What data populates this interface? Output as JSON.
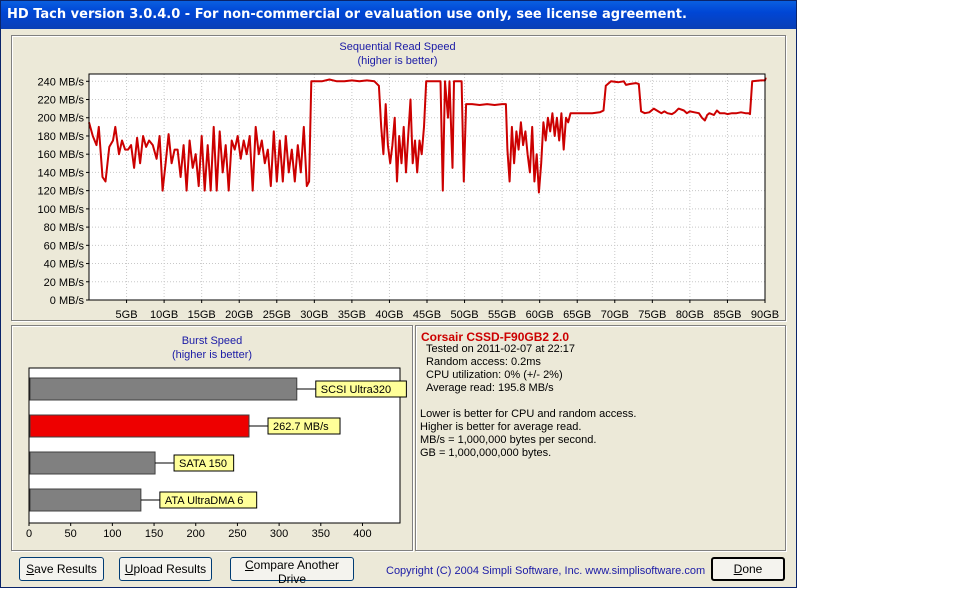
{
  "window": {
    "title": "HD Tach version 3.0.4.0  - For non-commercial or evaluation use only, see license agreement."
  },
  "sequential_chart": {
    "title": "Sequential Read Speed",
    "subtitle": "(higher is better)"
  },
  "burst_chart": {
    "title": "Burst Speed",
    "subtitle": "(higher is better)"
  },
  "info": {
    "drive_name": "Corsair CSSD-F90GB2 2.0",
    "tested_on": "Tested on 2011-02-07 at 22:17",
    "random_access": "Random access: 0.2ms",
    "cpu_utilization": "CPU utilization: 0% (+/- 2%)",
    "average_read": "Average read: 195.8 MB/s",
    "note1": "Lower is better for CPU and random access.",
    "note2": "Higher is better for average read.",
    "note3": "MB/s = 1,000,000 bytes per second.",
    "note4": "GB = 1,000,000,000 bytes."
  },
  "buttons": {
    "save_first": "S",
    "save_rest": "ave Results",
    "upload_first": "U",
    "upload_rest": "pload Results",
    "compare_first": "C",
    "compare_rest": "ompare Another Drive",
    "done_first": "D",
    "done_rest": "one"
  },
  "copyright": "Copyright (C) 2004 Simpli Software, Inc. www.simplisoftware.com",
  "colors": {
    "read_line": "#cc0000",
    "bar_default": "#808080",
    "bar_highlight": "#ee0000",
    "label_bg": "#ffff99",
    "chart_title": "#1a1aa6"
  },
  "chart_data": [
    {
      "type": "line",
      "title": "Sequential Read Speed",
      "subtitle": "(higher is better)",
      "x_ticks": [
        "5GB",
        "10GB",
        "15GB",
        "20GB",
        "25GB",
        "30GB",
        "35GB",
        "40GB",
        "45GB",
        "50GB",
        "55GB",
        "60GB",
        "65GB",
        "70GB",
        "75GB",
        "80GB",
        "85GB",
        "90GB"
      ],
      "y_ticks": [
        "0 MB/s",
        "20 MB/s",
        "40 MB/s",
        "60 MB/s",
        "80 MB/s",
        "100 MB/s",
        "120 MB/s",
        "140 MB/s",
        "160 MB/s",
        "180 MB/s",
        "200 MB/s",
        "220 MB/s",
        "240 MB/s"
      ],
      "xlim": [
        0,
        90
      ],
      "ylim": [
        0,
        248
      ],
      "grid": true,
      "series": [
        {
          "values": [
            [
              0,
              195
            ],
            [
              0.5,
              180
            ],
            [
              1,
              170
            ],
            [
              1.3,
              190
            ],
            [
              1.8,
              135
            ],
            [
              2.2,
              130
            ],
            [
              2.7,
              168
            ],
            [
              3.2,
              175
            ],
            [
              3.5,
              190
            ],
            [
              4,
              160
            ],
            [
              4.4,
              175
            ],
            [
              4.8,
              165
            ],
            [
              5.2,
              165
            ],
            [
              5.6,
              170
            ],
            [
              6,
              145
            ],
            [
              6.4,
              178
            ],
            [
              6.8,
              150
            ],
            [
              7.2,
              180
            ],
            [
              7.6,
              168
            ],
            [
              8,
              175
            ],
            [
              8.5,
              170
            ],
            [
              9,
              155
            ],
            [
              9.4,
              180
            ],
            [
              9.8,
              120
            ],
            [
              10.2,
              150
            ],
            [
              10.6,
              182
            ],
            [
              11,
              150
            ],
            [
              11.4,
              165
            ],
            [
              11.8,
              165
            ],
            [
              12.2,
              135
            ],
            [
              12.6,
              170
            ],
            [
              13,
              120
            ],
            [
              13.4,
              175
            ],
            [
              13.8,
              145
            ],
            [
              14.2,
              160
            ],
            [
              14.6,
              125
            ],
            [
              15,
              180
            ],
            [
              15.4,
              120
            ],
            [
              15.8,
              170
            ],
            [
              16.2,
              120
            ],
            [
              16.6,
              190
            ],
            [
              17,
              120
            ],
            [
              17.4,
              185
            ],
            [
              17.8,
              140
            ],
            [
              18.2,
              170
            ],
            [
              18.6,
              120
            ],
            [
              19,
              175
            ],
            [
              19.4,
              165
            ],
            [
              19.8,
              180
            ],
            [
              20.2,
              155
            ],
            [
              20.6,
              175
            ],
            [
              21,
              160
            ],
            [
              21.4,
              180
            ],
            [
              21.8,
              120
            ],
            [
              22.2,
              190
            ],
            [
              22.6,
              160
            ],
            [
              23,
              175
            ],
            [
              23.4,
              150
            ],
            [
              23.8,
              165
            ],
            [
              24.2,
              125
            ],
            [
              24.6,
              185
            ],
            [
              25,
              130
            ],
            [
              25.4,
              175
            ],
            [
              25.8,
              130
            ],
            [
              26.2,
              180
            ],
            [
              26.6,
              140
            ],
            [
              27,
              165
            ],
            [
              27.4,
              130
            ],
            [
              27.8,
              170
            ],
            [
              28.2,
              140
            ],
            [
              28.6,
              190
            ],
            [
              29,
              125
            ],
            [
              29.3,
              130
            ],
            [
              29.6,
              240
            ],
            [
              31,
              240
            ],
            [
              32,
              242
            ],
            [
              33,
              240
            ],
            [
              34,
              240
            ],
            [
              35,
              241
            ],
            [
              36,
              240
            ],
            [
              37,
              241
            ],
            [
              38,
              240
            ],
            [
              38.6,
              235
            ],
            [
              38.9,
              190
            ],
            [
              39.2,
              160
            ],
            [
              39.5,
              215
            ],
            [
              39.8,
              170
            ],
            [
              40.1,
              150
            ],
            [
              40.4,
              170
            ],
            [
              40.7,
              200
            ],
            [
              41,
              130
            ],
            [
              41.3,
              180
            ],
            [
              41.6,
              150
            ],
            [
              41.9,
              190
            ],
            [
              42.2,
              140
            ],
            [
              42.5,
              180
            ],
            [
              42.8,
              220
            ],
            [
              43.1,
              150
            ],
            [
              43.4,
              175
            ],
            [
              43.7,
              140
            ],
            [
              44,
              175
            ],
            [
              44.3,
              160
            ],
            [
              44.6,
              190
            ],
            [
              44.9,
              240
            ],
            [
              46.5,
              240
            ],
            [
              46.8,
              240
            ],
            [
              47.1,
              120
            ],
            [
              47.4,
              240
            ],
            [
              47.8,
              200
            ],
            [
              48,
              240
            ],
            [
              48.4,
              145
            ],
            [
              48.6,
              240
            ],
            [
              49.6,
              240
            ],
            [
              49.9,
              130
            ],
            [
              50.2,
              215
            ],
            [
              51,
              215
            ],
            [
              52,
              214
            ],
            [
              53,
              215
            ],
            [
              54,
              214
            ],
            [
              55,
              215
            ],
            [
              55.5,
              215
            ],
            [
              55.7,
              165
            ],
            [
              56,
              130
            ],
            [
              56.3,
              190
            ],
            [
              56.6,
              150
            ],
            [
              56.9,
              185
            ],
            [
              57.2,
              165
            ],
            [
              57.5,
              195
            ],
            [
              57.8,
              170
            ],
            [
              58.1,
              185
            ],
            [
              58.4,
              160
            ],
            [
              58.7,
              140
            ],
            [
              59,
              190
            ],
            [
              59.3,
              130
            ],
            [
              59.6,
              160
            ],
            [
              59.9,
              118
            ],
            [
              60.2,
              150
            ],
            [
              60.5,
              195
            ],
            [
              60.8,
              175
            ],
            [
              61.1,
              200
            ],
            [
              61.4,
              185
            ],
            [
              61.7,
              205
            ],
            [
              62,
              180
            ],
            [
              62.3,
              200
            ],
            [
              62.6,
              175
            ],
            [
              62.9,
              205
            ],
            [
              63.2,
              165
            ],
            [
              63.5,
              200
            ],
            [
              63.8,
              195
            ],
            [
              64.1,
              205
            ],
            [
              64.4,
              205
            ],
            [
              65,
              205
            ],
            [
              66,
              205
            ],
            [
              67,
              205
            ],
            [
              68,
              206
            ],
            [
              68.5,
              208
            ],
            [
              68.8,
              235
            ],
            [
              69.5,
              240
            ],
            [
              70.5,
              239
            ],
            [
              71.2,
              240
            ],
            [
              71.5,
              236
            ],
            [
              72,
              237
            ],
            [
              72.8,
              238
            ],
            [
              73.2,
              237
            ],
            [
              73.5,
              207
            ],
            [
              74,
              205
            ],
            [
              74.6,
              206
            ],
            [
              75.2,
              210
            ],
            [
              75.8,
              207
            ],
            [
              76.2,
              205
            ],
            [
              76.6,
              207
            ],
            [
              77,
              205
            ],
            [
              77.6,
              204
            ],
            [
              78,
              206
            ],
            [
              78.5,
              210
            ],
            [
              79.2,
              208
            ],
            [
              79.6,
              205
            ],
            [
              80,
              207
            ],
            [
              80.6,
              206
            ],
            [
              81.2,
              205
            ],
            [
              81.6,
              200
            ],
            [
              82,
              197
            ],
            [
              82.3,
              203
            ],
            [
              82.6,
              205
            ],
            [
              83.2,
              203
            ],
            [
              83.6,
              208
            ],
            [
              84,
              205
            ],
            [
              84.6,
              205
            ],
            [
              85,
              204
            ],
            [
              85.6,
              205
            ],
            [
              86.2,
              205
            ],
            [
              86.8,
              206
            ],
            [
              87.4,
              205
            ],
            [
              87.8,
              205
            ],
            [
              88,
              204
            ],
            [
              88.3,
              240
            ],
            [
              89.5,
              241
            ],
            [
              90,
              241
            ],
            [
              90.1,
              244
            ]
          ]
        }
      ]
    },
    {
      "type": "bar",
      "title": "Burst Speed",
      "subtitle": "(higher is better)",
      "orientation": "horizontal",
      "categories": [
        "SCSI Ultra320",
        "262.7 MB/s",
        "SATA 150",
        "ATA UltraDMA 6"
      ],
      "values": [
        320,
        262.7,
        150,
        133
      ],
      "highlight_index": 1,
      "x_ticks": [
        "0",
        "50",
        "100",
        "150",
        "200",
        "250",
        "300",
        "350",
        "400"
      ],
      "xlim": [
        0,
        445
      ]
    }
  ]
}
